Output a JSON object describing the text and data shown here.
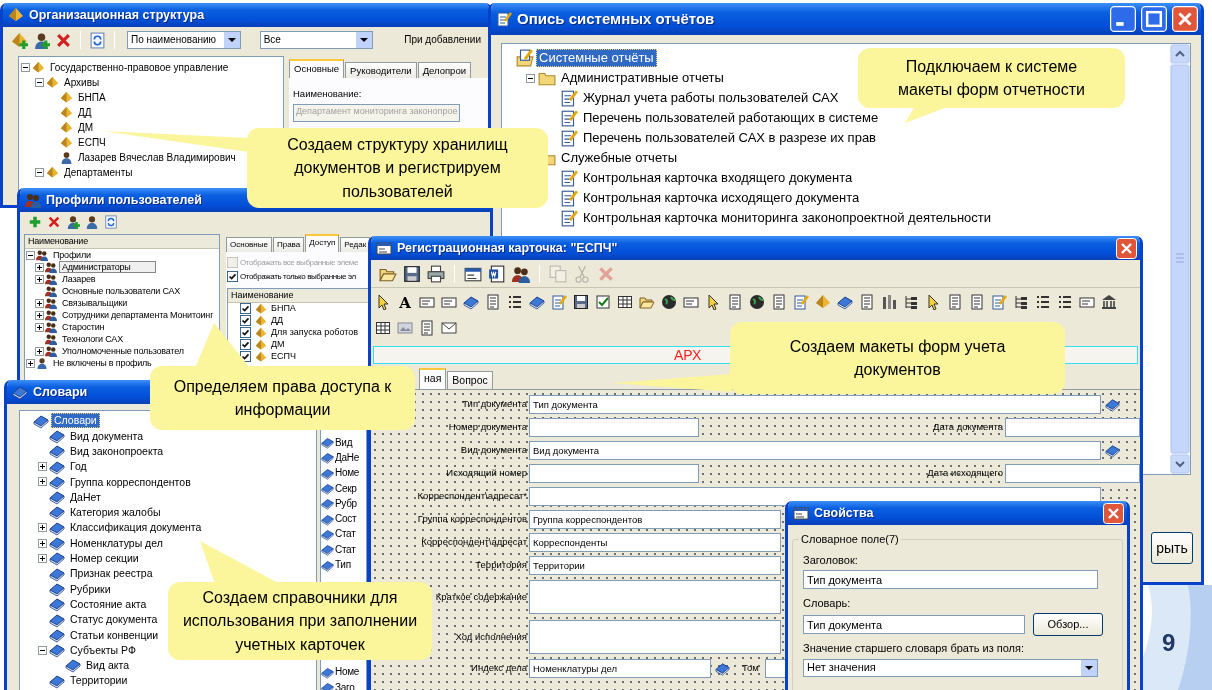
{
  "org_window": {
    "title": "Организационная структура",
    "toolbar": [
      {
        "kind": "pyramid-plus"
      },
      {
        "kind": "person-plus"
      },
      {
        "kind": "delete"
      },
      {
        "kind": "refresh"
      }
    ],
    "sort_select": "По наименованию",
    "filter_select": "Все",
    "add_label": "При добавлении",
    "tree": [
      {
        "text": "Государственно-правовое управление",
        "kind": "unit",
        "expanded": true,
        "selected": false,
        "children": [
          {
            "text": "Архивы",
            "kind": "unit",
            "expanded": true,
            "selected": false,
            "children": [
              {
                "text": "БНПА",
                "kind": "unit",
                "selected": false
              },
              {
                "text": "ДД",
                "kind": "unit",
                "selected": false
              },
              {
                "text": "ДМ",
                "kind": "unit",
                "selected": false
              },
              {
                "text": "ЕСПЧ",
                "kind": "unit",
                "selected": false
              },
              {
                "text": "Лазарев Вячеслав Владимирович",
                "kind": "person",
                "selected": false
              }
            ]
          },
          {
            "text": "Департаменты",
            "kind": "unit",
            "expanded": true,
            "selected": false
          }
        ]
      }
    ],
    "tabs": [
      {
        "label": "Основные",
        "selected": true
      },
      {
        "label": "Руководители",
        "selected": false
      },
      {
        "label": "Делопрои",
        "selected": false
      }
    ],
    "name_label": "Наименование:",
    "name_value": "Департамент мониторинга законопрое"
  },
  "reports_window": {
    "title": "Опись системных отчётов",
    "tree": [
      {
        "text": "Системные отчёты",
        "kind": "root",
        "selected": true,
        "children": [
          {
            "text": "Административные отчеты",
            "kind": "folder",
            "expanded": true,
            "selected": false,
            "children": [
              {
                "text": "Журнал учета работы пользователей САХ",
                "kind": "report",
                "selected": false
              },
              {
                "text": "Перечень пользователей работающих в системе",
                "kind": "report",
                "selected": false
              },
              {
                "text": "Перечень пользователей САХ в разрезе их прав",
                "kind": "report",
                "selected": false
              }
            ]
          },
          {
            "text": "Служебные отчеты",
            "kind": "folder",
            "selected": false,
            "children": [
              {
                "text": "Контрольная карточка входящего документа",
                "kind": "report",
                "selected": false
              },
              {
                "text": "Контрольная карточка исходящего документа",
                "kind": "report",
                "selected": false
              },
              {
                "text": "Контрольная карточка мониторинга законопроектной деятельности",
                "kind": "report",
                "selected": false
              }
            ]
          }
        ]
      }
    ],
    "close_button": "рыть"
  },
  "profiles_window": {
    "title": "Профили пользователей",
    "toolbar": [
      {
        "kind": "add"
      },
      {
        "kind": "delete"
      },
      {
        "kind": "person-plus"
      },
      {
        "kind": "person"
      },
      {
        "kind": "refresh"
      }
    ],
    "header": "Наименование",
    "tree": [
      {
        "text": "Профили",
        "kind": "group",
        "expanded": true,
        "selected": false,
        "children": [
          {
            "text": "Администраторы",
            "kind": "group",
            "expanded": false,
            "selected": true
          },
          {
            "text": "Лазарев",
            "kind": "group",
            "expanded": false,
            "selected": false
          },
          {
            "text": "Основные пользователи САХ",
            "kind": "group",
            "selected": false
          },
          {
            "text": "Связывальщики",
            "kind": "group",
            "expanded": false,
            "selected": false
          },
          {
            "text": "Сотрудники департамента Монитоинг",
            "kind": "group",
            "expanded": false,
            "selected": false
          },
          {
            "text": "Старостин",
            "kind": "group",
            "expanded": false,
            "selected": false
          },
          {
            "text": "Технологи САХ",
            "kind": "group",
            "selected": false
          },
          {
            "text": "Уполномоченные пользовател",
            "kind": "group",
            "expanded": false,
            "selected": false
          }
        ]
      },
      {
        "text": "Не включены в профиль",
        "kind": "person",
        "expanded": false,
        "selected": false
      }
    ],
    "tabs": [
      {
        "label": "Основные",
        "selected": false
      },
      {
        "label": "Права",
        "selected": false
      },
      {
        "label": "Доступ",
        "selected": true
      },
      {
        "label": "Редак",
        "selected": false
      }
    ],
    "options": [
      {
        "label": "Отображать все выбранные элеме",
        "checked": false,
        "disabled": true
      },
      {
        "label": "Отображать только выбранные эл",
        "checked": true,
        "disabled": false
      }
    ],
    "list_header": "Наименование",
    "list": [
      {
        "text": "БНПА",
        "checked": true
      },
      {
        "text": "ДД",
        "checked": true
      },
      {
        "text": "Для запуска роботов",
        "checked": true
      },
      {
        "text": "ДМ",
        "checked": true
      },
      {
        "text": "ЕСПЧ",
        "checked": true
      }
    ]
  },
  "dict_window": {
    "title": "Словари",
    "tree": [
      {
        "text": "Словари",
        "kind": "dictionary",
        "selected": true,
        "children": [
          {
            "text": "Вид документа",
            "kind": "dictionary",
            "selected": false
          },
          {
            "text": "Вид законопроекта",
            "kind": "dictionary",
            "selected": false
          },
          {
            "text": "Год",
            "kind": "dictionary",
            "expanded": false,
            "selected": false
          },
          {
            "text": "Группа корреспондентов",
            "kind": "dictionary",
            "expanded": false,
            "selected": false
          },
          {
            "text": "ДаНет",
            "kind": "dictionary",
            "selected": false
          },
          {
            "text": "Категория жалобы",
            "kind": "dictionary",
            "selected": false
          },
          {
            "text": "Классификация документа",
            "kind": "dictionary",
            "expanded": false,
            "selected": false
          },
          {
            "text": "Номенклатуры дел",
            "kind": "dictionary",
            "expanded": false,
            "selected": false
          },
          {
            "text": "Номер секции",
            "kind": "dictionary",
            "expanded": false,
            "selected": false
          },
          {
            "text": "Признак реестра",
            "kind": "dictionary",
            "selected": false
          },
          {
            "text": "Рубрики",
            "kind": "dictionary",
            "selected": false
          },
          {
            "text": "Состояние акта",
            "kind": "dictionary",
            "selected": false
          },
          {
            "text": "Статус документа",
            "kind": "dictionary",
            "selected": false
          },
          {
            "text": "Статьи конвенции",
            "kind": "dictionary",
            "selected": false
          },
          {
            "text": "Субъекты РФ",
            "kind": "dictionary",
            "expanded": true,
            "selected": false,
            "children": [
              {
                "text": "Вид акта",
                "kind": "dictionary",
                "selected": false
              }
            ]
          },
          {
            "text": "Территории",
            "kind": "dictionary",
            "selected": false
          }
        ]
      }
    ],
    "side_list_top": [
      "Вид",
      "ДаНе",
      "Номе",
      "Секр",
      "Рубр",
      "Сост",
      "Стат",
      "Стат",
      "Тип"
    ],
    "side_list_bottom": [
      "Номе",
      "Заго"
    ]
  },
  "card_window": {
    "title": "Регистрационная карточка: \"ЕСПЧ\"",
    "toolbar": [
      {
        "kind": "open",
        "disabled": false
      },
      {
        "kind": "save",
        "disabled": false
      },
      {
        "kind": "print",
        "disabled": false
      },
      {
        "kind": "separator"
      },
      {
        "kind": "props",
        "disabled": false
      },
      {
        "kind": "word",
        "disabled": false
      },
      {
        "kind": "people",
        "disabled": false
      },
      {
        "kind": "separator"
      },
      {
        "kind": "copy",
        "disabled": true
      },
      {
        "kind": "cut",
        "disabled": true
      },
      {
        "kind": "delete",
        "disabled": true
      }
    ],
    "tools": [
      {
        "kind": "cursor"
      },
      {
        "kind": "letter",
        "text": "A"
      },
      {
        "kind": "field"
      },
      {
        "kind": "field"
      },
      {
        "kind": "book"
      },
      {
        "kind": "doc"
      },
      {
        "kind": "list"
      },
      {
        "kind": "book"
      },
      {
        "kind": "report"
      },
      {
        "kind": "save"
      },
      {
        "kind": "check"
      },
      {
        "kind": "table"
      },
      {
        "kind": "open"
      },
      {
        "kind": "globe"
      },
      {
        "kind": "field"
      },
      {
        "kind": "cursor"
      },
      {
        "kind": "doc"
      },
      {
        "kind": "globe"
      },
      {
        "kind": "doc"
      },
      {
        "kind": "report"
      },
      {
        "kind": "pyramid"
      },
      {
        "kind": "book"
      },
      {
        "kind": "doc"
      },
      {
        "kind": "chart"
      },
      {
        "kind": "tree"
      },
      {
        "kind": "cursor"
      },
      {
        "kind": "doc"
      },
      {
        "kind": "doc"
      },
      {
        "kind": "report"
      },
      {
        "kind": "tree"
      },
      {
        "kind": "list"
      },
      {
        "kind": "list"
      },
      {
        "kind": "field"
      },
      {
        "kind": "bank"
      }
    ],
    "tools_row2": [
      {
        "kind": "table"
      },
      {
        "kind": "image"
      },
      {
        "kind": "doc"
      },
      {
        "kind": "envelope"
      }
    ],
    "banner": "АРХ",
    "tabs": [
      {
        "label": "ная",
        "selected": true
      },
      {
        "label": "Вопрос",
        "selected": false
      }
    ],
    "form": [
      {
        "kind": "wide",
        "label": "Тип документа",
        "value": "Тип документа",
        "lookup": true
      },
      {
        "kind": "pair",
        "label": "Номер документа",
        "second_label": "Дата документа"
      },
      {
        "kind": "wide",
        "label": "Вид документа",
        "value": "Вид документа",
        "lookup": true
      },
      {
        "kind": "pair",
        "label": "Исходящий номер",
        "second_label": "Дата исходящего"
      },
      {
        "kind": "wide",
        "label": "Корреспондент\\адресат*"
      },
      {
        "kind": "wide",
        "label": "Группа корреспондентов",
        "value": "Группа корреспондентов"
      },
      {
        "kind": "wide",
        "label": "Корреспондент\\адресат",
        "value": "Корреспонденты"
      },
      {
        "kind": "wide",
        "label": "Территория",
        "value": "Территории"
      },
      {
        "kind": "memo",
        "label": "Краткое содержание"
      },
      {
        "kind": "memo",
        "label": "Ход исполнения"
      },
      {
        "kind": "index",
        "label": "Индекс дела",
        "value": "Номенклатуры дел",
        "second_label": "Том",
        "lookup": true
      }
    ]
  },
  "props_window": {
    "title": "Свойства",
    "group": "Словарное поле(7)",
    "caption_label": "Заголовок:",
    "caption_value": "Тип документа",
    "dict_label": "Словарь:",
    "dict_value": "Тип документа",
    "browse_button": "Обзор...",
    "parent_label": "Значение старшего словаря брать из поля:",
    "parent_value": "Нет значения"
  },
  "callouts": [
    "Создаем структуру хранилищ\nдокументов  и регистрируем\nпользователей",
    "Определяем права доступа к\nинформации",
    "Создаем справочники для\nиспользования при заполнении\nучетных карточек",
    "Подключаем к системе\nмакеты форм отчетности",
    "Создаем макеты форм учета\nдокументов"
  ],
  "page_number": "9"
}
